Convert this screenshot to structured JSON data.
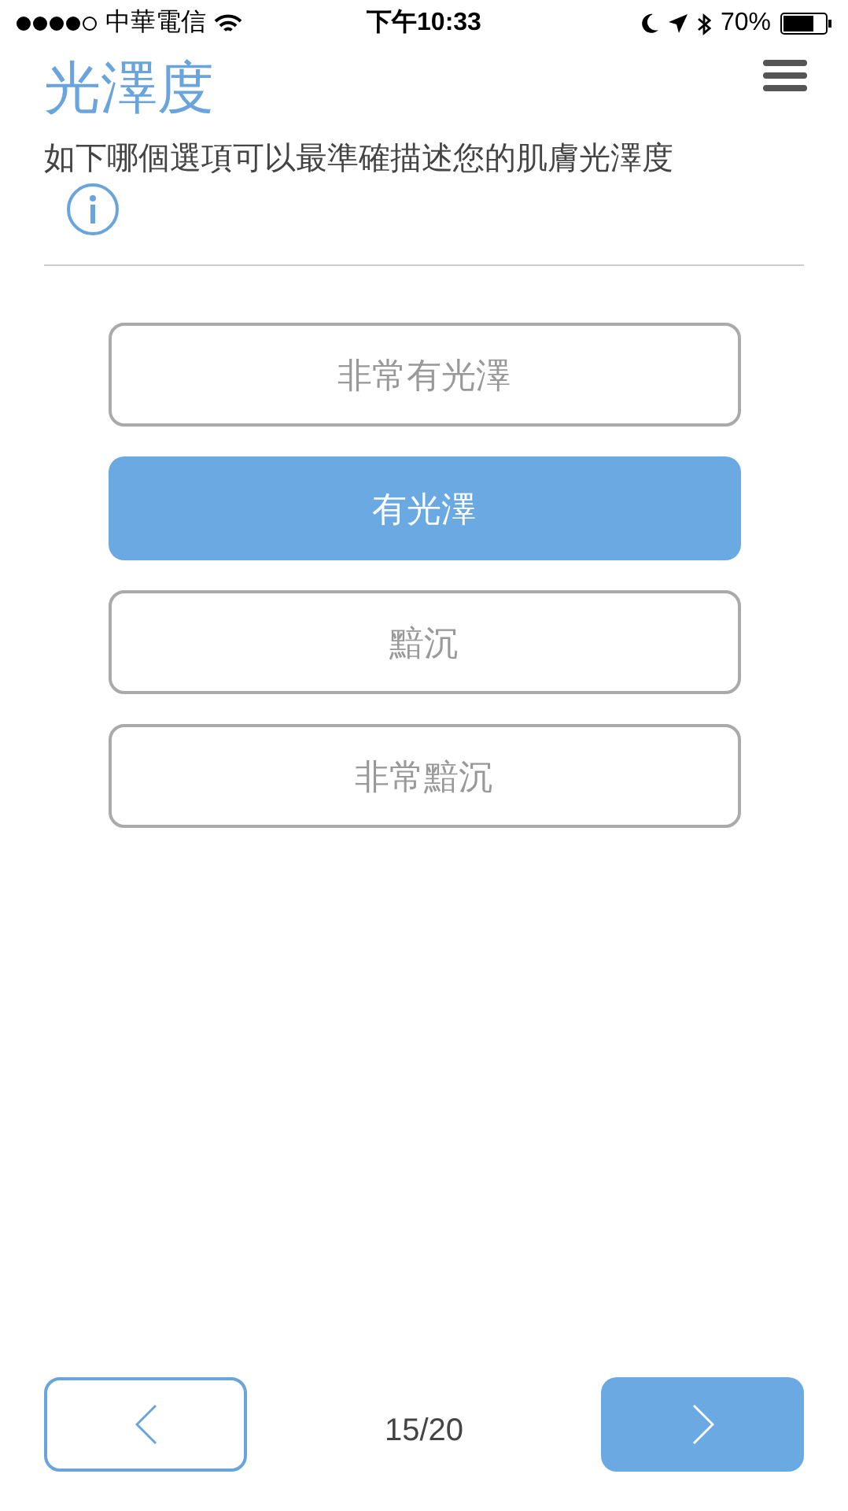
{
  "status_bar": {
    "carrier": "中華電信",
    "time": "下午10:33",
    "battery": "70%"
  },
  "title": "光澤度",
  "question": "如下哪個選項可以最準確描述您的肌膚光澤度",
  "options": [
    {
      "label": "非常有光澤",
      "selected": false
    },
    {
      "label": "有光澤",
      "selected": true
    },
    {
      "label": "黯沉",
      "selected": false
    },
    {
      "label": "非常黯沉",
      "selected": false
    }
  ],
  "pager": {
    "progress": "15/20"
  }
}
